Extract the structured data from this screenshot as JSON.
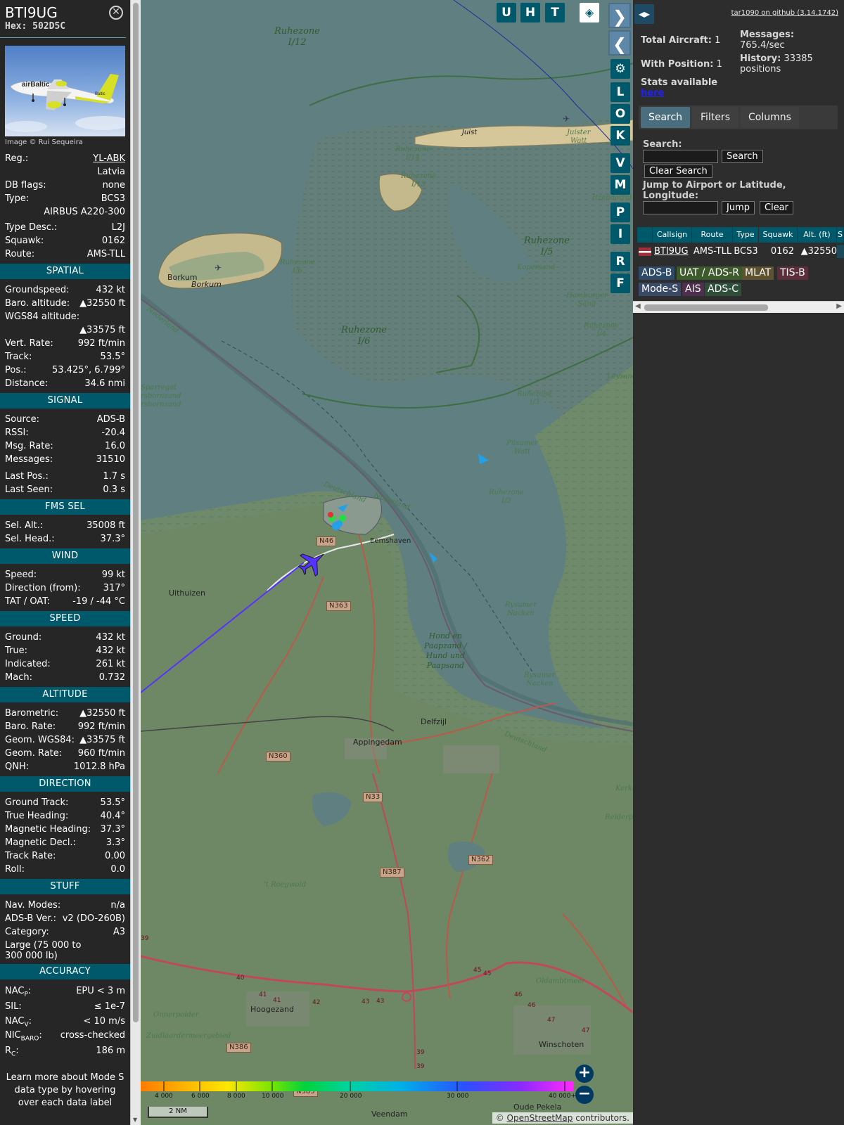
{
  "info": {
    "callsign": "BTI9UG",
    "hex": "Hex: 502D5C",
    "photo_airline_text": "airBaltic",
    "photo_tail_text": "Baltic",
    "photo_credit": "Image © Rui Sequeira",
    "reg_label": "Reg.:",
    "reg_value": "YL-ABK",
    "country": "Latvia",
    "dbflags_label": "DB flags:",
    "dbflags_value": "none",
    "type_label": "Type:",
    "type_value": "BCS3",
    "type_full": "AIRBUS A220-300",
    "typedesc_label": "Type Desc.:",
    "typedesc_value": "L2J",
    "squawk_label": "Squawk:",
    "squawk_value": "0162",
    "route_label": "Route:",
    "route_value": "AMS-TLL",
    "spatial": {
      "title": "SPATIAL",
      "rows": [
        {
          "k": "Groundspeed:",
          "v": "432 kt"
        },
        {
          "k": "Baro. altitude:",
          "v": "▲32550 ft"
        },
        {
          "k": "WGS84 altitude:",
          "v": ""
        },
        {
          "k": "",
          "v": "▲33575 ft"
        },
        {
          "k": "Vert. Rate:",
          "v": "992 ft/min"
        },
        {
          "k": "Track:",
          "v": "53.5°"
        },
        {
          "k": "Pos.:",
          "v": "53.425°, 6.799°"
        },
        {
          "k": "Distance:",
          "v": "34.6 nmi"
        }
      ]
    },
    "signal": {
      "title": "SIGNAL",
      "rows": [
        {
          "k": "Source:",
          "v": "ADS-B"
        },
        {
          "k": "RSSI:",
          "v": "-20.4"
        },
        {
          "k": "Msg. Rate:",
          "v": "16.0"
        },
        {
          "k": "Messages:",
          "v": "31510"
        },
        {
          "k": "Last Pos.:",
          "v": "1.7 s"
        },
        {
          "k": "Last Seen:",
          "v": "0.3 s"
        }
      ]
    },
    "fms": {
      "title": "FMS SEL",
      "rows": [
        {
          "k": "Sel. Alt.:",
          "v": "35008 ft"
        },
        {
          "k": "Sel. Head.:",
          "v": "37.3°"
        }
      ]
    },
    "wind": {
      "title": "WIND",
      "rows": [
        {
          "k": "Speed:",
          "v": "99 kt"
        },
        {
          "k": "Direction (from):",
          "v": "317°"
        },
        {
          "k": "TAT / OAT:",
          "v": "-19 / -44 °C"
        }
      ]
    },
    "speed": {
      "title": "SPEED",
      "rows": [
        {
          "k": "Ground:",
          "v": "432 kt"
        },
        {
          "k": "True:",
          "v": "432 kt"
        },
        {
          "k": "Indicated:",
          "v": "261 kt"
        },
        {
          "k": "Mach:",
          "v": "0.732"
        }
      ]
    },
    "altitude": {
      "title": "ALTITUDE",
      "rows": [
        {
          "k": "Barometric:",
          "v": "▲32550 ft"
        },
        {
          "k": "Baro. Rate:",
          "v": "992 ft/min"
        },
        {
          "k": "Geom. WGS84:",
          "v": "▲33575 ft"
        },
        {
          "k": "Geom. Rate:",
          "v": "960 ft/min"
        },
        {
          "k": "QNH:",
          "v": "1012.8 hPa"
        }
      ]
    },
    "direction": {
      "title": "DIRECTION",
      "rows": [
        {
          "k": "Ground Track:",
          "v": "53.5°"
        },
        {
          "k": "True Heading:",
          "v": "40.4°"
        },
        {
          "k": "Magnetic Heading:",
          "v": "37.3°"
        },
        {
          "k": "Magnetic Decl.:",
          "v": "3.3°"
        },
        {
          "k": "Track Rate:",
          "v": "0.00"
        },
        {
          "k": "Roll:",
          "v": "0.0"
        }
      ]
    },
    "stuff": {
      "title": "STUFF",
      "rows": [
        {
          "k": "Nav. Modes:",
          "v": "n/a"
        },
        {
          "k": "ADS-B Ver.:",
          "v": "v2 (DO-260B)"
        },
        {
          "k": "Category:",
          "v": "A3"
        }
      ],
      "category_desc": "Large (75 000 to 300 000 lb)"
    },
    "accuracy": {
      "title": "ACCURACY",
      "nacp_label": "NAC",
      "nacp_sub": "P",
      "nacp_value": "EPU < 3 m",
      "sil_label": "SIL:",
      "sil_value": "≤ 1e-7",
      "nacv_label": "NAC",
      "nacv_sub": "V",
      "nacv_value": "< 10 m/s",
      "nic_label": "NIC",
      "nic_sub": "BARO",
      "nic_value": "cross-checked",
      "rc_label": "R",
      "rc_sub": "C",
      "rc_value": "186 m"
    },
    "learn_more": "Learn more about Mode S data type by hovering over each data label"
  },
  "map": {
    "labels_water": [
      {
        "text": "Ruhezone\nI/12"
      },
      {
        "text": "Ruhezone\nI/5"
      },
      {
        "text": "Ruhezone\nI/6"
      },
      {
        "text": "Hond en\nPaapzand /\nHund und\nPaapsand"
      }
    ],
    "labels_small": [
      {
        "text": "Ruhezone\nI/14"
      },
      {
        "text": "Ruhezone\nI/13"
      },
      {
        "text": "Ruhezone\nI/6"
      },
      {
        "text": "Ruhezone\nI/3"
      },
      {
        "text": "Ruhezone\nI/2"
      },
      {
        "text": "Ruhezone\nI/4"
      },
      {
        "text": "Kopersand"
      },
      {
        "text": "Hamburger\nSand"
      },
      {
        "text": "Pilsumer\nWatt"
      },
      {
        "text": "Rysumer\nNacken"
      },
      {
        "text": "Rysumer\nNacken"
      },
      {
        "text": "Nederland"
      },
      {
        "text": "Deutschland"
      },
      {
        "text": "Nederland"
      },
      {
        "text": "Deutschland"
      },
      {
        "text": "Itzendorfpl"
      },
      {
        "text": "Juister\nWatt"
      },
      {
        "text": "Leysand"
      },
      {
        "text": "Kerke"
      },
      {
        "text": "Reiderpl"
      },
      {
        "text": "Oldambtmeer"
      },
      {
        "text": "Zuidlaardermeergebied"
      },
      {
        "text": "Onnerpolder"
      },
      {
        "text": "'t Roegwold"
      },
      {
        "text": "Sparregat\nrsbornzand\nrsbornzand"
      }
    ],
    "towns": [
      {
        "text": "Juist"
      },
      {
        "text": "Borkum"
      },
      {
        "text": "Borkum"
      },
      {
        "text": "Eemshaven"
      },
      {
        "text": "Uithuizen"
      },
      {
        "text": "Delfzijl"
      },
      {
        "text": "Appingedam"
      },
      {
        "text": "Hoogezand"
      },
      {
        "text": "Winschoten"
      },
      {
        "text": "Veendam"
      },
      {
        "text": "Oude Pekela"
      }
    ],
    "roads": [
      {
        "text": "N46"
      },
      {
        "text": "N363"
      },
      {
        "text": "N360"
      },
      {
        "text": "N33"
      },
      {
        "text": "N362"
      },
      {
        "text": "N387"
      },
      {
        "text": "N386"
      },
      {
        "text": "N385"
      }
    ],
    "motorway_numbers": [
      "40",
      "41",
      "41",
      "42",
      "43",
      "43",
      "45",
      "45",
      "46",
      "46",
      "47",
      "47",
      "39",
      "39",
      "39"
    ],
    "buttons": {
      "u": "U",
      "h": "H",
      "t": "T",
      "l": "L",
      "o": "O",
      "k": "K",
      "v": "V",
      "m": "M",
      "p": "P",
      "i": "I",
      "r": "R",
      "f": "F",
      "next": "❯",
      "prev": "❮",
      "settings": "⚙",
      "layers": "◈"
    },
    "zoom_in": "+",
    "zoom_out": "−",
    "alt_ticks": [
      "4 000",
      "6 000",
      "8 000",
      "10 000",
      "20 000",
      "30 000",
      "40 000+"
    ],
    "scale": "2 NM",
    "attribution_prefix": "© ",
    "attribution_link": "OpenStreetMap",
    "attribution_suffix": " contributors.",
    "colors": {
      "water": "#5f7f80",
      "land": "#6f8a66",
      "track": "#5533ff",
      "aircraft": "#5533ff"
    }
  },
  "right": {
    "toggle_label": "◂▸",
    "github_link": "tar1090 on github (3.14.1742)",
    "total_aircraft_label": "Total Aircraft:",
    "total_aircraft_value": "1",
    "with_position_label": "With Position:",
    "with_position_value": "1",
    "messages_label": "Messages:",
    "messages_value": "765.4/sec",
    "history_label": "History:",
    "history_value": "33385 positions",
    "stats_label": "Stats available",
    "stats_link": "here",
    "tabs": [
      "Search",
      "Filters",
      "Columns"
    ],
    "search_label": "Search:",
    "search_button": "Search",
    "clear_search_button": "Clear Search",
    "jump_label": "Jump to Airport or Latitude, Longitude:",
    "jump_button": "Jump",
    "clear_button": "Clear",
    "columns": [
      "",
      "Callsign",
      "Route",
      "Type",
      "Squawk",
      "Alt. (ft)",
      "S"
    ],
    "rows": [
      {
        "callsign": "BTI9UG",
        "route": "AMS-TLL",
        "type": "BCS3",
        "squawk": "0162",
        "alt": "▲32550"
      }
    ],
    "legend": [
      {
        "label": "ADS-B",
        "color": "#2e4a66",
        "text": "#ffffff"
      },
      {
        "label": "UAT / ADS-R",
        "color": "#3d5a2d",
        "text": "#ffffff"
      },
      {
        "label": "MLAT",
        "color": "#5c5230",
        "text": "#ffffff"
      },
      {
        "label": "TIS-B",
        "color": "#5a2f3a",
        "text": "#ffffff"
      },
      {
        "label": "Mode-S",
        "color": "#3a4a66",
        "text": "#ffffff"
      },
      {
        "label": "AIS",
        "color": "#4e2f4e",
        "text": "#ffffff"
      },
      {
        "label": "ADS-C",
        "color": "#2f4e3a",
        "text": "#ffffff"
      }
    ]
  }
}
